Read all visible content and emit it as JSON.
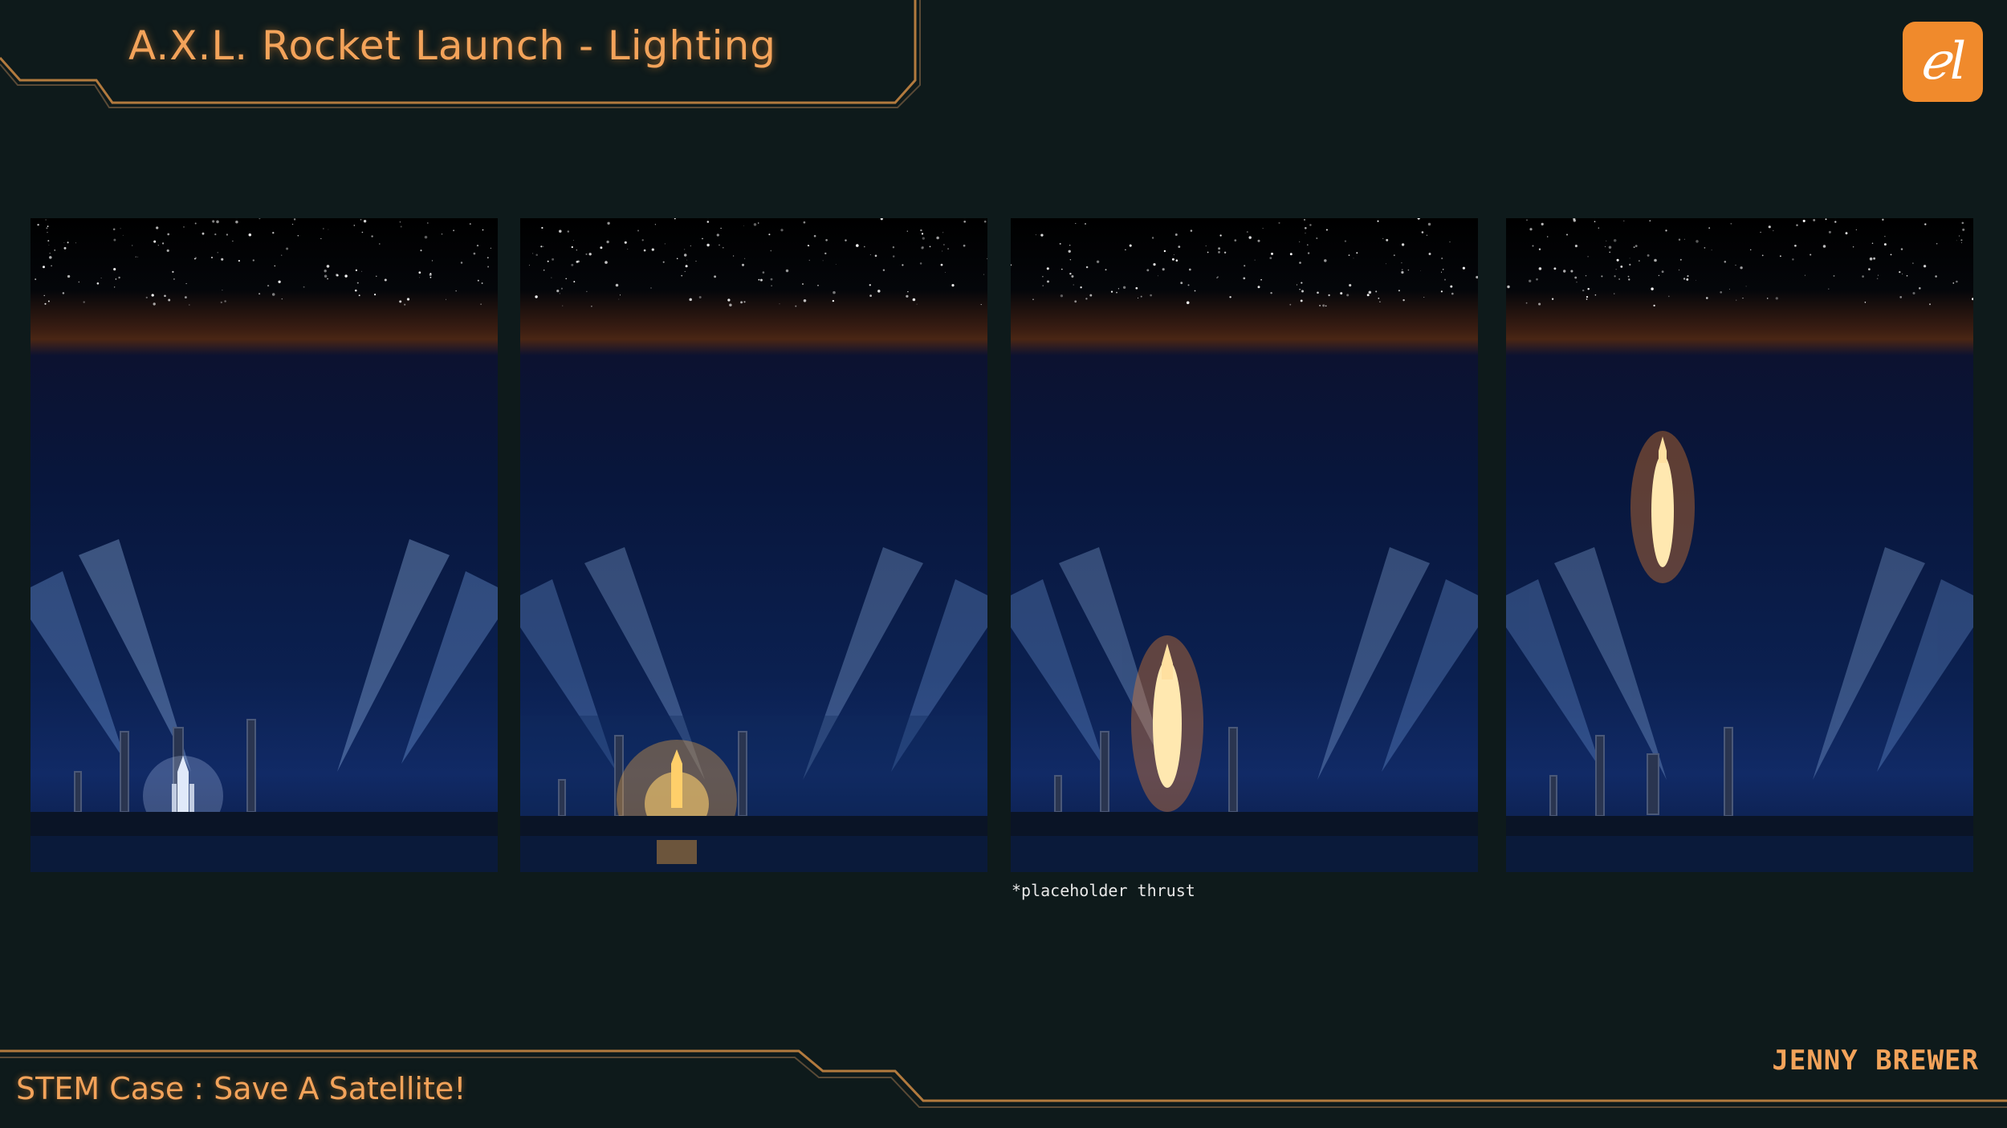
{
  "header": {
    "title": "A.X.L. Rocket Launch - Lighting"
  },
  "footer": {
    "subtitle": "STEM Case : Save A Satellite!",
    "author": "JENNY BREWER"
  },
  "logo": {
    "glyph": "ℯl",
    "color": "#f08a2c"
  },
  "accent_color": "#f3a35a",
  "frame_color": "#b27a3e",
  "panels": [
    {
      "stage": "idle"
    },
    {
      "stage": "ignition"
    },
    {
      "stage": "liftoff"
    },
    {
      "stage": "ascent"
    }
  ],
  "note": "*placeholder thrust"
}
